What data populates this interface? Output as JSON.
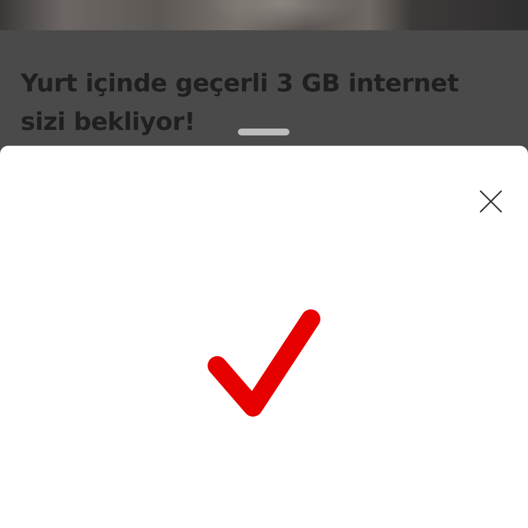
{
  "offer": {
    "title_line1": "Yurt içinde geçerli 3 GB internet",
    "title_line2": "sizi bekliyor!"
  },
  "bottom_sheet": {
    "status": "success",
    "check_color": "#e60000",
    "icons": {
      "close": "close-icon",
      "status": "checkmark-icon"
    }
  },
  "colors": {
    "overlay": "#4a4a4a",
    "sheet": "#ffffff",
    "title_text": "#1f1f1f",
    "handle": "#bdbdbd"
  }
}
